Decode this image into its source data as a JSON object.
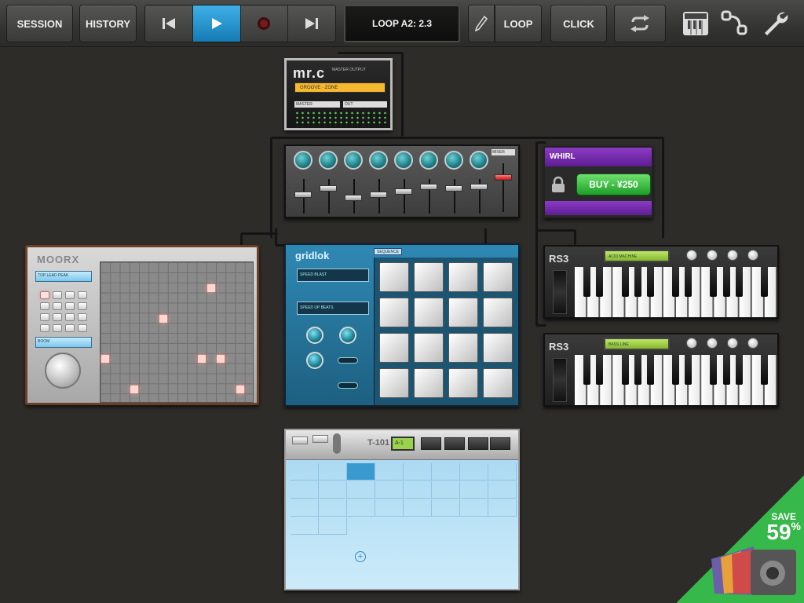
{
  "toolbar": {
    "session": "SESSION",
    "history": "HISTORY",
    "loop_display": "LOOP A2: 2.3",
    "loop": "LOOP",
    "click": "CLICK",
    "icons": [
      "rewind-icon",
      "play-icon",
      "record-icon",
      "skip-forward-icon",
      "pencil-icon",
      "repeat-icon",
      "keyboard-icon",
      "patch-icon",
      "wrench-icon"
    ]
  },
  "modules": {
    "mrc": {
      "logo": "mr.c",
      "sub": "MASTER OUTPUT",
      "bar": "GROOVE · ZONE",
      "lcd_left": "MASTER",
      "lcd_right": "OUT"
    },
    "mixer": {
      "label": "MIXER"
    },
    "whirl": {
      "name": "WHIRL",
      "buy": "BUY - ¥250"
    },
    "moorx": {
      "brand": "MOORX",
      "lcd1": "TOP LEAD PEAK",
      "lcd2": "BOOM"
    },
    "gridlok": {
      "brand": "gridlok",
      "badge": "SEQUENCE",
      "lcd1": "SPEED BLAST",
      "lcd2": "SPEED UP BEATS"
    },
    "rs3_a": {
      "brand": "RS3",
      "display": "ACID MACHINE"
    },
    "rs3_b": {
      "brand": "RS3",
      "display": "BASS LINE"
    },
    "t101": {
      "name": "T-101",
      "display": "A-1",
      "add": "+"
    }
  },
  "promo": {
    "label": "SAVE",
    "percent": "59",
    "suffix": "%"
  }
}
